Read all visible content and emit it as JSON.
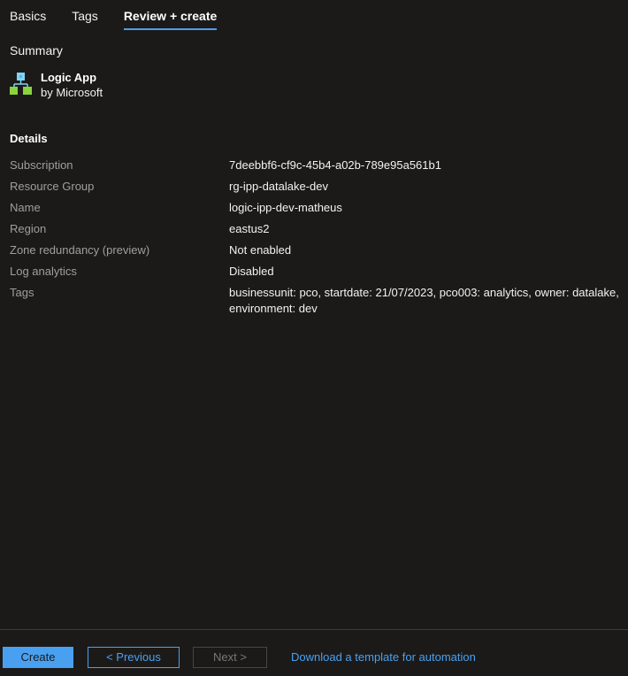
{
  "tabs": [
    {
      "label": "Basics"
    },
    {
      "label": "Tags"
    },
    {
      "label": "Review + create"
    }
  ],
  "summary": {
    "title": "Summary",
    "product_name": "Logic App",
    "product_vendor": "by Microsoft",
    "product_icon": "logic-app-icon"
  },
  "details": {
    "title": "Details",
    "rows": [
      {
        "key": "Subscription",
        "value": "7deebbf6-cf9c-45b4-a02b-789e95a561b1"
      },
      {
        "key": "Resource Group",
        "value": "rg-ipp-datalake-dev"
      },
      {
        "key": "Name",
        "value": "logic-ipp-dev-matheus"
      },
      {
        "key": "Region",
        "value": "eastus2"
      },
      {
        "key": "Zone redundancy (preview)",
        "value": "Not enabled"
      },
      {
        "key": "Log analytics",
        "value": "Disabled"
      },
      {
        "key": "Tags",
        "value": "businessunit: pco, startdate: 21/07/2023, pco003: analytics, owner: datalake, environment: dev"
      }
    ]
  },
  "footer": {
    "create_label": "Create",
    "previous_label": "< Previous",
    "next_label": "Next >",
    "download_label": "Download a template for automation"
  },
  "colors": {
    "background": "#1b1a19",
    "accent": "#4aa0f0",
    "muted_text": "#a19f9d"
  }
}
